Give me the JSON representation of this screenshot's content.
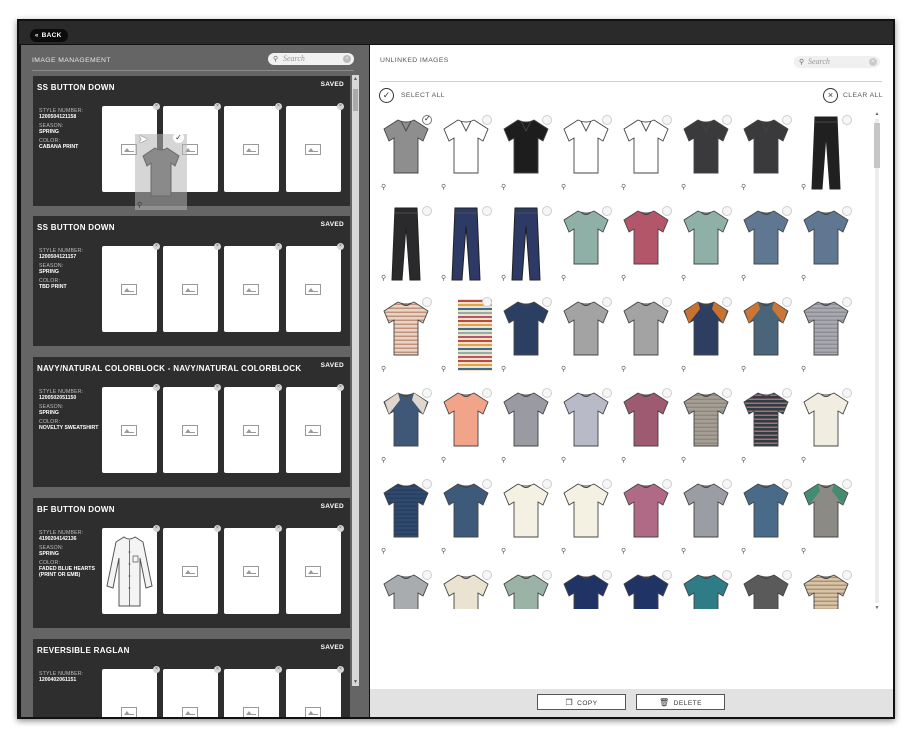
{
  "toolbar": {
    "back_label": "BACK"
  },
  "left_panel": {
    "title": "IMAGE MANAGEMENT",
    "search_placeholder": "Search",
    "meta_labels": {
      "style_number": "STYLE NUMBER:",
      "season": "SEASON:",
      "color": "COLOR:"
    },
    "cards": [
      {
        "name": "SS BUTTON DOWN",
        "status": "SAVED",
        "style_number": "1200504121158",
        "season": "SPRING",
        "color": "CABANA PRINT"
      },
      {
        "name": "SS BUTTON DOWN",
        "status": "SAVED",
        "style_number": "1200504121157",
        "season": "SPRING",
        "color": "TBD PRINT"
      },
      {
        "name": "NAVY/NATURAL COLORBLOCK - NAVY/NATURAL COLORBLOCK",
        "status": "SAVED",
        "style_number": "1200502051150",
        "season": "SPRING",
        "color": "NOVELTY SWEATSHIRT"
      },
      {
        "name": "BF BUTTON DOWN",
        "status": "SAVED",
        "style_number": "4190204142136",
        "season": "SPRING",
        "color": "FADED BLUE HEARTS (PRINT OR EMB)"
      },
      {
        "name": "REVERSIBLE RAGLAN",
        "status": "SAVED",
        "style_number": "1200402061151",
        "season": "",
        "color": ""
      }
    ]
  },
  "right_panel": {
    "title": "UNLINKED IMAGES",
    "search_placeholder": "Search",
    "select_all_label": "SELECT ALL",
    "clear_all_label": "CLEAR ALL"
  },
  "garments": [
    {
      "type": "vtee",
      "color": "#8e8e8e",
      "selected": true
    },
    {
      "type": "vtee",
      "color": "#ffffff"
    },
    {
      "type": "vtee",
      "color": "#1d1d1d"
    },
    {
      "type": "vtee",
      "color": "#ffffff"
    },
    {
      "type": "vtee",
      "color": "#ffffff"
    },
    {
      "type": "vtee",
      "color": "#3a3a3c"
    },
    {
      "type": "vtee",
      "color": "#3a3a3c"
    },
    {
      "type": "pants",
      "color": "#202020"
    },
    {
      "type": "pants",
      "color": "#2a2a2c"
    },
    {
      "type": "pants",
      "color": "#2d3a66"
    },
    {
      "type": "pants",
      "color": "#2d3a66"
    },
    {
      "type": "tee",
      "color": "#8fb0a6"
    },
    {
      "type": "tee",
      "color": "#b3566a"
    },
    {
      "type": "tee",
      "color": "#8fb0a6"
    },
    {
      "type": "tee",
      "color": "#5f7790"
    },
    {
      "type": "tee",
      "color": "#5f7790"
    },
    {
      "type": "tee",
      "color": "#e9d3c2",
      "stripe": "#b98a74"
    },
    {
      "type": "strip",
      "color": "#f0e2cc",
      "stripe": "#c04a3a"
    },
    {
      "type": "tee",
      "color": "#2b3f63"
    },
    {
      "type": "tee",
      "color": "#a3a3a3"
    },
    {
      "type": "tee",
      "color": "#a3a3a3"
    },
    {
      "type": "tee",
      "color": "#2e3e60",
      "accent": "#d9782e"
    },
    {
      "type": "tee",
      "color": "#4a6579",
      "accent": "#d9782e"
    },
    {
      "type": "tee",
      "color": "#a9a9b0",
      "stripe": "#8a8a92"
    },
    {
      "type": "tee",
      "color": "#3f5878",
      "accent": "#f1e6d6"
    },
    {
      "type": "tee",
      "color": "#f2a48a"
    },
    {
      "type": "tee",
      "color": "#9a9aa2"
    },
    {
      "type": "tee",
      "color": "#b9bac8"
    },
    {
      "type": "tee",
      "color": "#9d5a70"
    },
    {
      "type": "tee",
      "color": "#a59f95",
      "stripe": "#8a8479"
    },
    {
      "type": "tee",
      "color": "#2d3f45",
      "stripe": "#c7707a"
    },
    {
      "type": "tee",
      "color": "#f1ede0"
    },
    {
      "type": "tee",
      "color": "#2e4a70",
      "stripe": "#263c5c"
    },
    {
      "type": "tee",
      "color": "#3d5a7a"
    },
    {
      "type": "tee",
      "color": "#f4f0e2"
    },
    {
      "type": "tee",
      "color": "#f4f0e2"
    },
    {
      "type": "tee",
      "color": "#b06a86"
    },
    {
      "type": "tee",
      "color": "#9a9da3"
    },
    {
      "type": "tee",
      "color": "#4a6a8a"
    },
    {
      "type": "tee",
      "color": "#8c8a85",
      "accent": "#3b8c6f"
    },
    {
      "type": "tee",
      "color": "#a9acaf"
    },
    {
      "type": "tee",
      "color": "#ebe3d2"
    },
    {
      "type": "tee",
      "color": "#9bb3a6"
    },
    {
      "type": "tee",
      "color": "#1f3464"
    },
    {
      "type": "tee",
      "color": "#1f3464"
    },
    {
      "type": "tee",
      "color": "#2f7c86"
    },
    {
      "type": "tee",
      "color": "#5a5a5a"
    },
    {
      "type": "tee",
      "color": "#d8c5a8",
      "stripe": "#a78a6a"
    }
  ],
  "footer": {
    "copy_label": "COPY",
    "delete_label": "DELETE"
  }
}
